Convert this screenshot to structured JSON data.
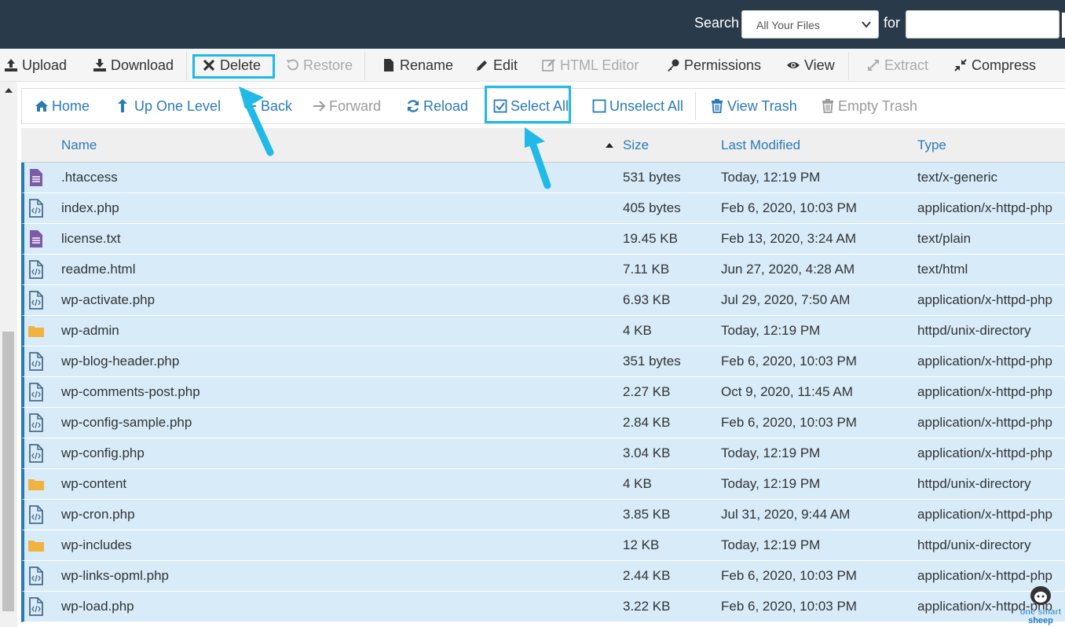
{
  "header": {
    "search_label": "Search",
    "search_scope": "All Your Files",
    "for_label": "for",
    "search_value": ""
  },
  "toolbar": {
    "upload": "Upload",
    "download": "Download",
    "delete": "Delete",
    "restore": "Restore",
    "rename": "Rename",
    "edit": "Edit",
    "html_editor": "HTML Editor",
    "permissions": "Permissions",
    "view": "View",
    "extract": "Extract",
    "compress": "Compress"
  },
  "nav": {
    "home": "Home",
    "up": "Up One Level",
    "back": "Back",
    "forward": "Forward",
    "reload": "Reload",
    "select_all": "Select All",
    "unselect_all": "Unselect All",
    "view_trash": "View Trash",
    "empty_trash": "Empty Trash"
  },
  "table": {
    "columns": [
      "Name",
      "Size",
      "Last Modified",
      "Type"
    ],
    "rows": [
      {
        "icon": "text-file-icon",
        "name": ".htaccess",
        "size": "531 bytes",
        "modified": "Today, 12:19 PM",
        "type": "text/x-generic"
      },
      {
        "icon": "code-file-icon",
        "name": "index.php",
        "size": "405 bytes",
        "modified": "Feb 6, 2020, 10:03 PM",
        "type": "application/x-httpd-php"
      },
      {
        "icon": "text-file-icon",
        "name": "license.txt",
        "size": "19.45 KB",
        "modified": "Feb 13, 2020, 3:24 AM",
        "type": "text/plain"
      },
      {
        "icon": "code-file-icon",
        "name": "readme.html",
        "size": "7.11 KB",
        "modified": "Jun 27, 2020, 4:28 AM",
        "type": "text/html"
      },
      {
        "icon": "code-file-icon",
        "name": "wp-activate.php",
        "size": "6.93 KB",
        "modified": "Jul 29, 2020, 7:50 AM",
        "type": "application/x-httpd-php"
      },
      {
        "icon": "folder-icon",
        "name": "wp-admin",
        "size": "4 KB",
        "modified": "Today, 12:19 PM",
        "type": "httpd/unix-directory"
      },
      {
        "icon": "code-file-icon",
        "name": "wp-blog-header.php",
        "size": "351 bytes",
        "modified": "Feb 6, 2020, 10:03 PM",
        "type": "application/x-httpd-php"
      },
      {
        "icon": "code-file-icon",
        "name": "wp-comments-post.php",
        "size": "2.27 KB",
        "modified": "Oct 9, 2020, 11:45 AM",
        "type": "application/x-httpd-php"
      },
      {
        "icon": "code-file-icon",
        "name": "wp-config-sample.php",
        "size": "2.84 KB",
        "modified": "Feb 6, 2020, 10:03 PM",
        "type": "application/x-httpd-php"
      },
      {
        "icon": "code-file-icon",
        "name": "wp-config.php",
        "size": "3.04 KB",
        "modified": "Today, 12:19 PM",
        "type": "application/x-httpd-php"
      },
      {
        "icon": "folder-icon",
        "name": "wp-content",
        "size": "4 KB",
        "modified": "Today, 12:19 PM",
        "type": "httpd/unix-directory"
      },
      {
        "icon": "code-file-icon",
        "name": "wp-cron.php",
        "size": "3.85 KB",
        "modified": "Jul 31, 2020, 9:44 AM",
        "type": "application/x-httpd-php"
      },
      {
        "icon": "folder-icon",
        "name": "wp-includes",
        "size": "12 KB",
        "modified": "Today, 12:19 PM",
        "type": "httpd/unix-directory"
      },
      {
        "icon": "code-file-icon",
        "name": "wp-links-opml.php",
        "size": "2.44 KB",
        "modified": "Feb 6, 2020, 10:03 PM",
        "type": "application/x-httpd-php"
      },
      {
        "icon": "code-file-icon",
        "name": "wp-load.php",
        "size": "3.22 KB",
        "modified": "Feb 6, 2020, 10:03 PM",
        "type": "application/x-httpd-php"
      }
    ]
  },
  "watermark": "one smart sheep",
  "colors": {
    "header_bg": "#293a4a",
    "link": "#2a7ab8",
    "row_selected": "#d7ebf9",
    "highlight": "#20b9e8",
    "folder": "#f0b342",
    "text_file": "#7b5aa6",
    "code_file": "#4d6a87"
  }
}
